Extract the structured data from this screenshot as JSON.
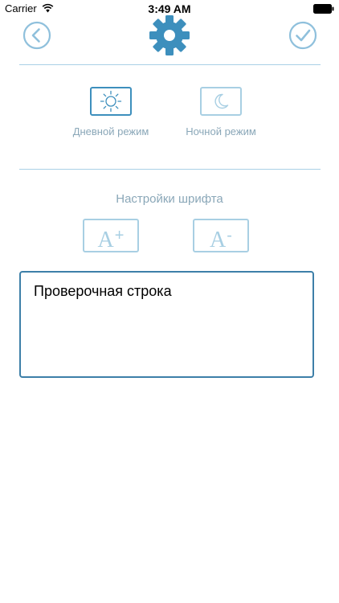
{
  "status_bar": {
    "carrier": "Carrier",
    "time": "3:49 AM",
    "wifi_icon": "wifi-icon",
    "battery_icon": "battery-icon"
  },
  "header": {
    "back_icon": "chevron-left-circle-icon",
    "logo_icon": "gear-icon",
    "done_icon": "checkmark-circle-icon"
  },
  "theme": {
    "day_label": "Дневной режим",
    "night_label": "Ночной режим",
    "day_icon": "sun-icon",
    "night_icon": "moon-icon",
    "selected": "day"
  },
  "font": {
    "title": "Настройки шрифта",
    "increase_letter": "A",
    "increase_sign": "+",
    "decrease_letter": "A",
    "decrease_sign": "-"
  },
  "preview": {
    "text": "Проверочная строка"
  },
  "colors": {
    "accent": "#3d8fbd",
    "accent_light": "#a8cfe3",
    "label": "#8aa7b8"
  }
}
